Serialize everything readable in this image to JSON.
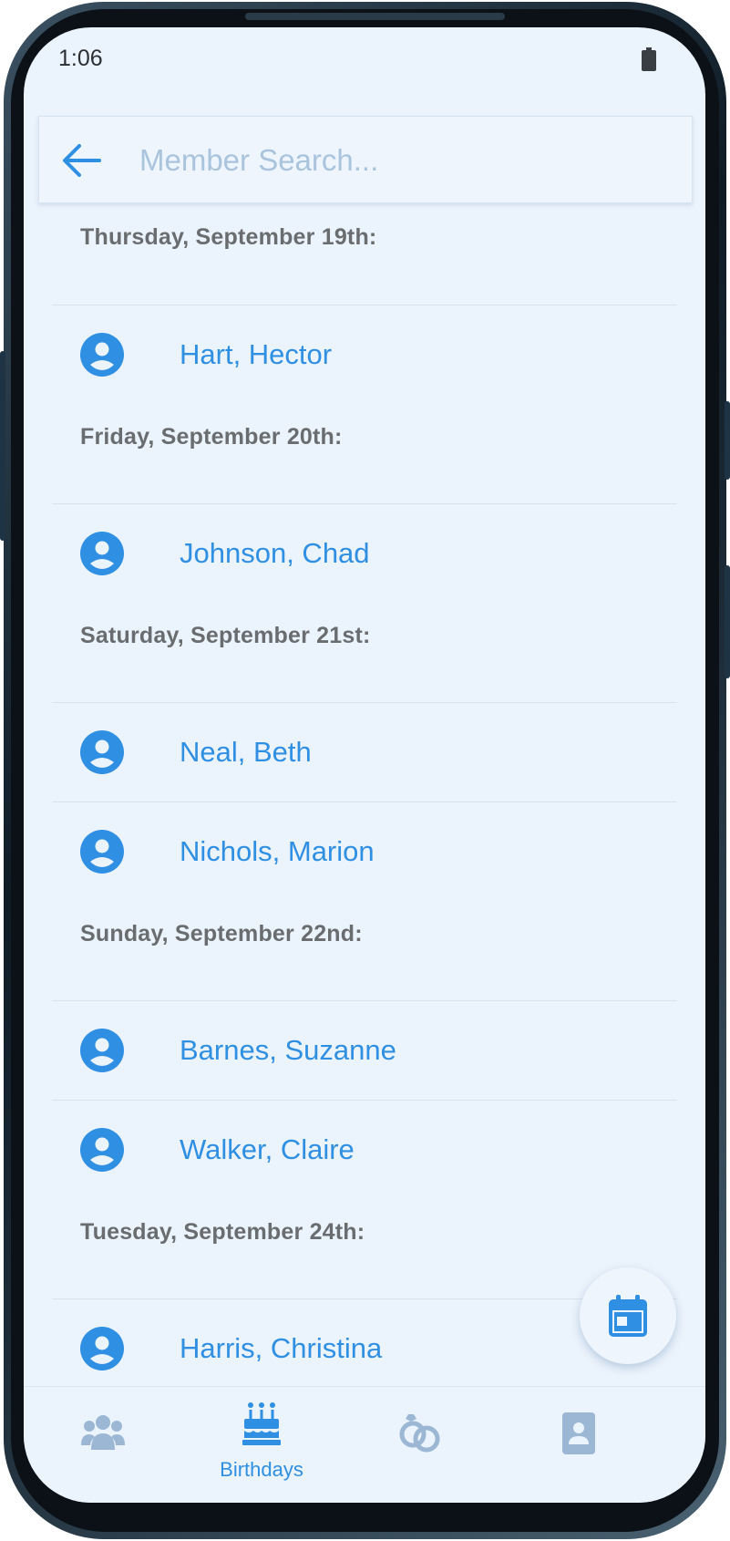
{
  "status_bar": {
    "time": "1:06",
    "battery_icon": "battery-icon"
  },
  "search": {
    "value": "",
    "placeholder": "Member Search...",
    "back_icon": "arrow-left-icon"
  },
  "sections": [
    {
      "date": "Thursday, September 19th:",
      "members": [
        "Hart, Hector"
      ]
    },
    {
      "date": "Friday, September 20th:",
      "members": [
        "Johnson, Chad"
      ]
    },
    {
      "date": "Saturday, September 21st:",
      "members": [
        "Neal, Beth",
        "Nichols, Marion"
      ]
    },
    {
      "date": "Sunday, September 22nd:",
      "members": [
        "Barnes, Suzanne",
        "Walker, Claire"
      ]
    },
    {
      "date": "Tuesday, September 24th:",
      "members": [
        "Harris, Christina"
      ]
    }
  ],
  "member_icon": "account-circle-icon",
  "fab": {
    "icon": "calendar-icon"
  },
  "bottom_nav": {
    "items": [
      {
        "icon": "users-icon",
        "label": "",
        "active": false
      },
      {
        "icon": "birthday-cake-icon",
        "label": "Birthdays",
        "active": true
      },
      {
        "icon": "rings-icon",
        "label": "",
        "active": false
      },
      {
        "icon": "contact-card-icon",
        "label": "",
        "active": false
      }
    ]
  },
  "colors": {
    "accent": "#2f8fe3",
    "inactive_icon": "#9bb7d4",
    "background": "#ebf3fc",
    "header_text": "#6a6d70"
  }
}
